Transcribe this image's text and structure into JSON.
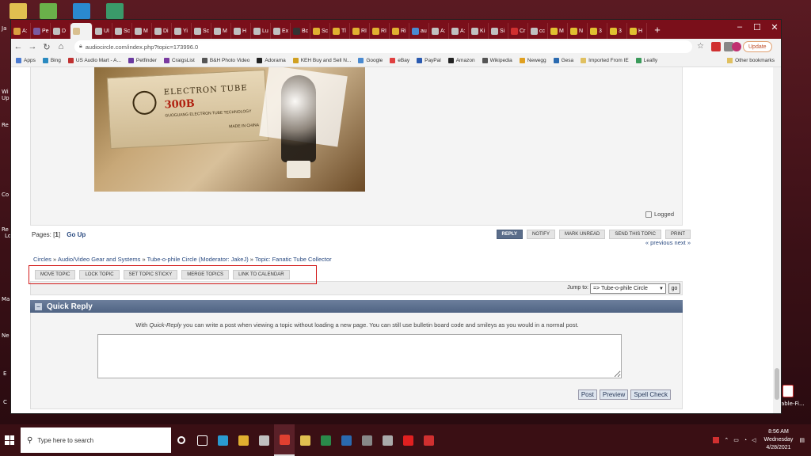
{
  "desktop": {
    "labels": [
      "Ja",
      "Wi",
      "Up",
      "Re",
      "Co",
      "Re",
      "Lo",
      "Ma",
      "Ne",
      "E",
      "C",
      "able-Fi..."
    ]
  },
  "browser": {
    "tabs": [
      {
        "label": "A:",
        "color": "#d9a040"
      },
      {
        "label": "Pe",
        "color": "#7a5aa0"
      },
      {
        "label": "D",
        "color": "#c0c0c0"
      },
      {
        "label": "",
        "color": "#d9c090",
        "active": true
      },
      {
        "label": "UI",
        "color": "#c0c0c0"
      },
      {
        "label": "Sc",
        "color": "#c0c0c0"
      },
      {
        "label": "M",
        "color": "#c0c0c0"
      },
      {
        "label": "Di",
        "color": "#c0c0c0"
      },
      {
        "label": "Yi",
        "color": "#c0c0c0"
      },
      {
        "label": "Sc",
        "color": "#c0c0c0"
      },
      {
        "label": "M",
        "color": "#c0c0c0"
      },
      {
        "label": "H",
        "color": "#c0c0c0"
      },
      {
        "label": "Lu",
        "color": "#c0c0c0"
      },
      {
        "label": "Ex",
        "color": "#c0c0c0"
      },
      {
        "label": "Bc",
        "color": "#333333"
      },
      {
        "label": "Sc",
        "color": "#e0b030"
      },
      {
        "label": "Tl",
        "color": "#e0b030"
      },
      {
        "label": "RI",
        "color": "#e0b030"
      },
      {
        "label": "RI",
        "color": "#e0b030"
      },
      {
        "label": "Ri",
        "color": "#e0b030"
      },
      {
        "label": "au",
        "color": "#4a8ad0"
      },
      {
        "label": "A:",
        "color": "#c0c0c0"
      },
      {
        "label": "A:",
        "color": "#c0c0c0"
      },
      {
        "label": "Ki",
        "color": "#c0c0c0"
      },
      {
        "label": "Si",
        "color": "#c0c0c0"
      },
      {
        "label": "Cr",
        "color": "#d03030"
      },
      {
        "label": "cc",
        "color": "#c0c0c0"
      },
      {
        "label": "M",
        "color": "#e0c030"
      },
      {
        "label": "N",
        "color": "#e0c030"
      },
      {
        "label": "3",
        "color": "#e0c030"
      },
      {
        "label": "3",
        "color": "#e0c030"
      },
      {
        "label": "H",
        "color": "#e0c030"
      }
    ],
    "new_tab": "+",
    "window_controls": {
      "minimize": "–",
      "maximize": "☐",
      "close": "✕"
    },
    "url": "audiocircle.com/index.php?topic=173996.0",
    "update_label": "Update",
    "bookmarks": [
      {
        "label": "Apps",
        "color": "#4a7ad0"
      },
      {
        "label": "Bing",
        "color": "#2a8ac0"
      },
      {
        "label": "US Audio Mart - A...",
        "color": "#c03030"
      },
      {
        "label": "Petfinder",
        "color": "#6a3aa0"
      },
      {
        "label": "CraigsList",
        "color": "#7a3aa0"
      },
      {
        "label": "B&H Photo Video",
        "color": "#555555"
      },
      {
        "label": "Adorama",
        "color": "#222222"
      },
      {
        "label": "KEH Buy and Sell N...",
        "color": "#d0a020"
      },
      {
        "label": "Google",
        "color": "#4a8ad0"
      },
      {
        "label": "eBay",
        "color": "#e04040"
      },
      {
        "label": "PayPal",
        "color": "#2a5ab0"
      },
      {
        "label": "Amazon",
        "color": "#222222"
      },
      {
        "label": "Wikipedia",
        "color": "#555555"
      },
      {
        "label": "Newegg",
        "color": "#e0a020"
      },
      {
        "label": "Gesa",
        "color": "#2a6ab0"
      },
      {
        "label": "Imported From IE",
        "color": "#e0c060"
      },
      {
        "label": "Leafly",
        "color": "#3a9a5a"
      }
    ],
    "other_bookmarks": "Other bookmarks"
  },
  "post": {
    "box_title": "ELECTRON TUBE",
    "box_model": "300B",
    "box_sub": "GUOGUANG ELECTRON TUBE TECHNOLOGY",
    "box_china": "MADE IN CHINA",
    "logged": "Logged"
  },
  "pages": {
    "label": "Pages: [",
    "current": "1",
    "close": "]",
    "go_up": "Go Up"
  },
  "post_buttons": [
    "REPLY",
    "NOTIFY",
    "MARK UNREAD",
    "SEND THIS TOPIC",
    "PRINT"
  ],
  "prev_next": "« previous next »",
  "breadcrumb": {
    "items": [
      "Circles",
      "Audio/Video Gear and Systems",
      "Tube-o-phile Circle",
      "Topic: Fanatic Tube Collector"
    ],
    "moderator": "(Moderator: JakeJ)",
    "sep": " » "
  },
  "mod_buttons": [
    "MOVE TOPIC",
    "LOCK TOPIC",
    "SET TOPIC STICKY",
    "MERGE TOPICS",
    "LINK TO CALENDAR"
  ],
  "jump": {
    "label": "Jump to:",
    "selected": "=> Tube-o-phile Circle",
    "go": "go"
  },
  "quick_reply": {
    "title": "Quick Reply",
    "toggle": "–",
    "desc_pre": "With ",
    "desc_em": "Quick-Reply",
    "desc_post": " you can write a post when viewing a topic without loading a new page. You can still use bulletin board code and smileys as you would in a normal post.",
    "buttons": [
      "Post",
      "Preview",
      "Spell Check"
    ]
  },
  "taskbar": {
    "search_placeholder": "Type here to search",
    "apps": [
      {
        "name": "cortana",
        "color": "#ffffff"
      },
      {
        "name": "task-view",
        "color": "#ffffff"
      },
      {
        "name": "edge",
        "color": "#2a9ad0"
      },
      {
        "name": "explorer",
        "color": "#e0b030"
      },
      {
        "name": "store",
        "color": "#c0c0c0"
      },
      {
        "name": "chrome",
        "color": "#e04030",
        "active": true
      },
      {
        "name": "folder",
        "color": "#e0c050"
      },
      {
        "name": "excel",
        "color": "#2a8a4a"
      },
      {
        "name": "outlook",
        "color": "#2a6ab0"
      },
      {
        "name": "app",
        "color": "#888888"
      },
      {
        "name": "app2",
        "color": "#aaaaaa"
      },
      {
        "name": "opera",
        "color": "#e02020"
      },
      {
        "name": "acrobat",
        "color": "#d03030"
      }
    ],
    "time": "8:56 AM",
    "day": "Wednesday",
    "date": "4/28/2021"
  }
}
